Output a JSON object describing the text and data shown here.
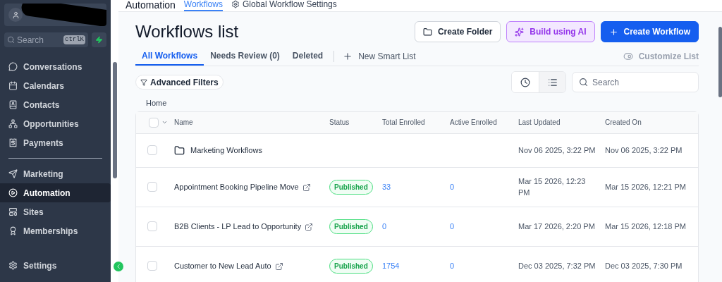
{
  "sidebar": {
    "search": {
      "placeholder": "Search",
      "shortcut": "ctrlK"
    },
    "nav_groups": [
      [
        {
          "label": "Conversations",
          "selected": false
        },
        {
          "label": "Calendars",
          "selected": false
        },
        {
          "label": "Contacts",
          "selected": false
        },
        {
          "label": "Opportunities",
          "selected": false
        },
        {
          "label": "Payments",
          "selected": false
        }
      ],
      [
        {
          "label": "Marketing",
          "selected": false
        },
        {
          "label": "Automation",
          "selected": true
        },
        {
          "label": "Sites",
          "selected": false
        },
        {
          "label": "Memberships",
          "selected": false
        }
      ]
    ],
    "settings": "Settings"
  },
  "header": {
    "title": "Automation",
    "tabs": [
      {
        "label": "Workflows",
        "selected": true
      },
      {
        "label": "Global Workflow Settings",
        "selected": false
      }
    ]
  },
  "page_title": "Workflows list",
  "actions": [
    "Create Folder",
    "Build using AI",
    "Create Workflow"
  ],
  "list_tabs": [
    {
      "label": "All Workflows",
      "selected": true
    },
    {
      "label": "Needs Review (0)",
      "selected": false
    },
    {
      "label": "Deleted",
      "selected": false
    }
  ],
  "new_smart_list": "New Smart List",
  "customize_list": "Customize List",
  "advanced_filters": "Advanced Filters",
  "view_toggle": [
    {
      "selected": false
    },
    {
      "selected": true
    }
  ],
  "search": {
    "placeholder": "Search"
  },
  "breadcrumb": "Home",
  "table": {
    "select_all_checked": false,
    "columns": [
      "Name",
      "Status",
      "Total Enrolled",
      "Active Enrolled",
      "Last Updated",
      "Created On"
    ],
    "rows": [
      {
        "kind": "folder",
        "name": "Marketing Workflows",
        "last_updated": "Nov 06 2025, 3:22 PM",
        "created_on": "Nov 06 2025, 3:22 PM",
        "checked": false
      },
      {
        "kind": "workflow",
        "name": "Appointment Booking Pipeline Move",
        "status": "Published",
        "total_enrolled": "33",
        "active_enrolled": "0",
        "last_updated": "Mar 15 2026, 12:23 PM",
        "created_on": "Mar 15 2026, 12:21 PM",
        "checked": false
      },
      {
        "kind": "workflow",
        "name": "B2B Clients - LP Lead to Opportunity",
        "status": "Published",
        "total_enrolled": "0",
        "active_enrolled": "0",
        "last_updated": "Mar 17 2026, 2:20 PM",
        "created_on": "Mar 15 2026, 12:18 PM",
        "checked": false
      },
      {
        "kind": "workflow",
        "name": "Customer to New Lead Auto",
        "status": "Published",
        "total_enrolled": "1754",
        "active_enrolled": "0",
        "last_updated": "Dec 03 2025, 7:32 PM",
        "created_on": "Dec 03 2025, 7:30 PM",
        "checked": false
      }
    ]
  }
}
